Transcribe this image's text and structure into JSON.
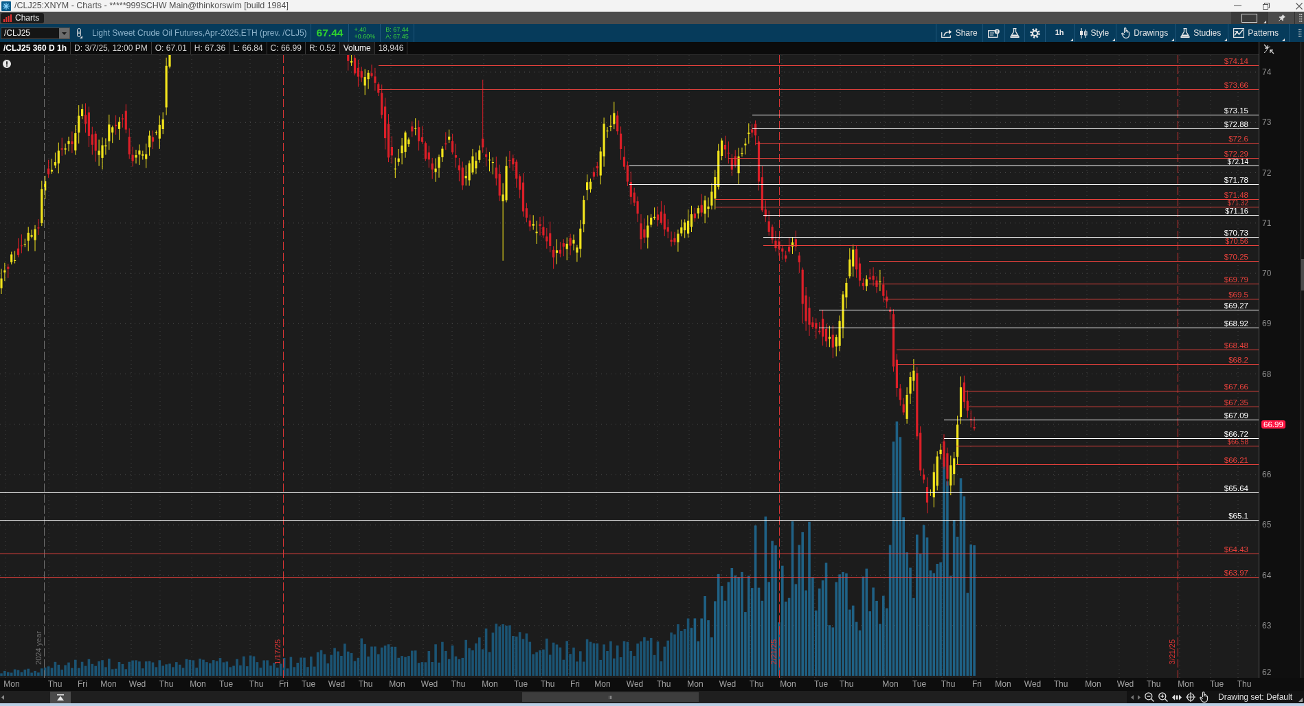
{
  "window": {
    "title": "/CLJ25:XNYM - Charts - *****999SCHW Main@thinkorswim [build 1984]"
  },
  "tabs": [
    {
      "label": "Charts",
      "selected": true
    }
  ],
  "toolbar": {
    "symbol": "/CLJ25",
    "description": "Light Sweet Crude Oil Futures,Apr-2025,ETH (prev. /CLJ5)",
    "last": "67.44",
    "change": "+.40",
    "change_percent": "+0.60%",
    "bid": "B: 67.44",
    "ask": "A: 67.45",
    "buttons": [
      {
        "kind": "share",
        "label": "Share",
        "menu": false
      },
      {
        "kind": "publish",
        "menu": false
      },
      {
        "kind": "lab",
        "menu": false
      },
      {
        "kind": "settings",
        "menu": false
      },
      {
        "kind": "interval",
        "label": "1h",
        "menu": true
      },
      {
        "kind": "style",
        "label": "Style",
        "menu": true
      },
      {
        "kind": "drawings",
        "label": "Drawings",
        "menu": true
      },
      {
        "kind": "studies",
        "label": "Studies",
        "menu": true
      },
      {
        "kind": "patterns",
        "label": "Patterns",
        "menu": true
      }
    ]
  },
  "chart_info": {
    "title": "/CLJ25 360 D 1h",
    "fields": [
      "D: 3/7/25, 12:00 PM",
      "O: 67.01",
      "H: 67.36",
      "L: 66.84",
      "C: 66.99",
      "R: 0.52"
    ],
    "study": "Volume",
    "study_value": "18,946"
  },
  "chart": {
    "price_levels": [
      {
        "label": "$74.14",
        "color": "#e8413c"
      },
      {
        "label": "$73.66",
        "color": "#e8413c"
      },
      {
        "label": "$73.15",
        "color": "#ffffff"
      },
      {
        "label": "$72.88",
        "color": "#ffffff"
      },
      {
        "label": "$72.6",
        "color": "#e8413c"
      },
      {
        "label": "$72.29",
        "color": "#e8413c"
      },
      {
        "label": "$72.14",
        "color": "#ffffff"
      },
      {
        "label": "$71.78",
        "color": "#ffffff"
      },
      {
        "label": "$71.48",
        "color": "#e8413c"
      },
      {
        "label": "$71.32",
        "color": "#e8413c"
      },
      {
        "label": "$71.16",
        "color": "#ffffff"
      },
      {
        "label": "$70.73",
        "color": "#ffffff"
      },
      {
        "label": "$70.56",
        "color": "#e8413c"
      },
      {
        "label": "$70.25",
        "color": "#e8413c"
      },
      {
        "label": "$69.79",
        "color": "#e8413c"
      },
      {
        "label": "$69.5",
        "color": "#e8413c"
      },
      {
        "label": "$69.27",
        "color": "#ffffff"
      },
      {
        "label": "$68.92",
        "color": "#ffffff"
      },
      {
        "label": "$68.48",
        "color": "#e8413c"
      },
      {
        "label": "$68.2",
        "color": "#e8413c"
      },
      {
        "label": "$67.66",
        "color": "#e8413c"
      },
      {
        "label": "$67.35",
        "color": "#e8413c"
      },
      {
        "label": "$67.09",
        "color": "#ffffff"
      },
      {
        "label": "$66.72",
        "color": "#ffffff"
      },
      {
        "label": "$66.58",
        "color": "#e8413c"
      },
      {
        "label": "$66.21",
        "color": "#e8413c"
      },
      {
        "label": "$65.64",
        "color": "#ffffff"
      },
      {
        "label": "$65.1",
        "color": "#ffffff"
      },
      {
        "label": "$64.43",
        "color": "#e8413c"
      },
      {
        "label": "$63.97",
        "color": "#e8413c"
      }
    ],
    "markers": [
      {
        "label": "2024 year",
        "color": "#6e6e6e"
      },
      {
        "label": "1/17/25",
        "color": "#d83434"
      },
      {
        "label": "2/21/25",
        "color": "#d83434"
      },
      {
        "label": "3/21/25",
        "color": "#d83434"
      }
    ],
    "y_axis": [
      "74",
      "73",
      "72",
      "71",
      "70",
      "69",
      "68",
      "66",
      "65",
      "64",
      "63",
      "62"
    ],
    "current_price": "66.99",
    "x_axis": [
      "Mon",
      "Thu",
      "Fri",
      "Mon",
      "Wed",
      "Thu",
      "Mon",
      "Tue",
      "Thu",
      "Fri",
      "Tue",
      "Wed",
      "Thu",
      "Mon",
      "Wed",
      "Thu",
      "Mon",
      "Tue",
      "Thu",
      "Fri",
      "Mon",
      "Wed",
      "Thu",
      "Mon",
      "Wed",
      "Thu",
      "Mon",
      "Tue",
      "Thu",
      "Mon",
      "Tue",
      "Thu",
      "Fri",
      "Mon",
      "Wed",
      "Thu",
      "Mon",
      "Wed",
      "Thu",
      "Mon",
      "Tue",
      "Thu"
    ]
  },
  "status_bar": {
    "drawing_set": "Drawing set: Default"
  }
}
